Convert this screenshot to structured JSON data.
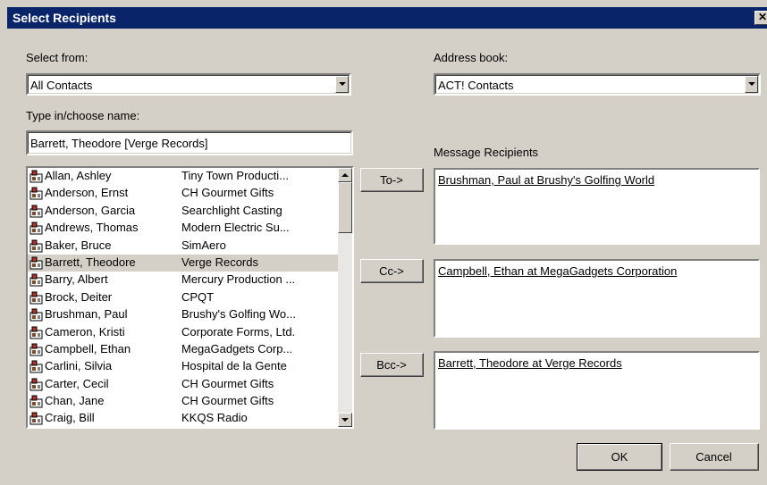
{
  "window": {
    "title": "Select Recipients"
  },
  "select_from": {
    "label": "Select from:",
    "value": "All Contacts"
  },
  "address_book": {
    "label": "Address book:",
    "value": "ACT! Contacts"
  },
  "name_entry": {
    "label": "Type in/choose name:",
    "value": "Barrett, Theodore [Verge Records]"
  },
  "contacts": [
    {
      "name": "Allan, Ashley",
      "company": "Tiny Town Producti..."
    },
    {
      "name": "Anderson, Ernst",
      "company": "CH Gourmet Gifts"
    },
    {
      "name": "Anderson, Garcia",
      "company": "Searchlight Casting"
    },
    {
      "name": "Andrews, Thomas",
      "company": "Modern Electric Su..."
    },
    {
      "name": "Baker, Bruce",
      "company": "SimAero"
    },
    {
      "name": "Barrett, Theodore",
      "company": "Verge Records",
      "selected": true
    },
    {
      "name": "Barry, Albert",
      "company": "Mercury Production ..."
    },
    {
      "name": "Brock, Deiter",
      "company": "CPQT"
    },
    {
      "name": "Brushman, Paul",
      "company": "Brushy's Golfing Wo..."
    },
    {
      "name": "Cameron, Kristi",
      "company": "Corporate Forms, Ltd."
    },
    {
      "name": "Campbell, Ethan",
      "company": "MegaGadgets Corp..."
    },
    {
      "name": "Carlini, Silvia",
      "company": "Hospital de la Gente"
    },
    {
      "name": "Carter, Cecil",
      "company": "CH Gourmet Gifts"
    },
    {
      "name": "Chan, Jane",
      "company": "CH Gourmet Gifts"
    },
    {
      "name": "Craig, Bill",
      "company": "KKQS Radio"
    }
  ],
  "recipients": {
    "label": "Message Recipients",
    "to_button": "To->",
    "cc_button": "Cc->",
    "bcc_button": "Bcc->",
    "to": "Brushman, Paul at Brushy's Golfing World",
    "cc": "Campbell, Ethan at MegaGadgets Corporation",
    "bcc": "Barrett, Theodore at Verge Records"
  },
  "footer": {
    "ok": "OK",
    "cancel": "Cancel"
  },
  "icons": {
    "close": "close-icon",
    "contact": "contact-card-icon",
    "dropdown": "chevron-down-icon"
  },
  "colors": {
    "titlebar": "#0a246a",
    "dialog": "#d4d0c8",
    "selection": "#d4d0c8"
  }
}
